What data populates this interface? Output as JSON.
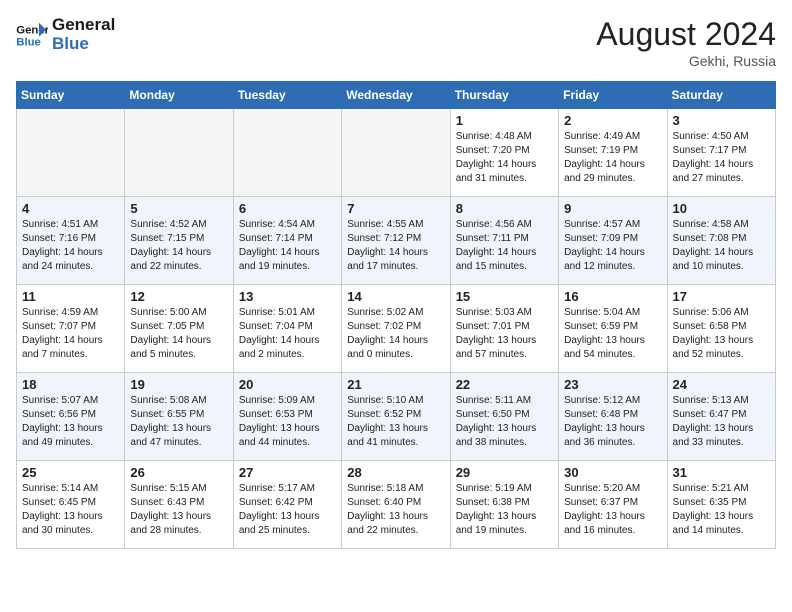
{
  "header": {
    "logo_line1": "General",
    "logo_line2": "Blue",
    "month_year": "August 2024",
    "location": "Gekhi, Russia"
  },
  "weekdays": [
    "Sunday",
    "Monday",
    "Tuesday",
    "Wednesday",
    "Thursday",
    "Friday",
    "Saturday"
  ],
  "weeks": [
    [
      {
        "day": "",
        "info": ""
      },
      {
        "day": "",
        "info": ""
      },
      {
        "day": "",
        "info": ""
      },
      {
        "day": "",
        "info": ""
      },
      {
        "day": "1",
        "info": "Sunrise: 4:48 AM\nSunset: 7:20 PM\nDaylight: 14 hours\nand 31 minutes."
      },
      {
        "day": "2",
        "info": "Sunrise: 4:49 AM\nSunset: 7:19 PM\nDaylight: 14 hours\nand 29 minutes."
      },
      {
        "day": "3",
        "info": "Sunrise: 4:50 AM\nSunset: 7:17 PM\nDaylight: 14 hours\nand 27 minutes."
      }
    ],
    [
      {
        "day": "4",
        "info": "Sunrise: 4:51 AM\nSunset: 7:16 PM\nDaylight: 14 hours\nand 24 minutes."
      },
      {
        "day": "5",
        "info": "Sunrise: 4:52 AM\nSunset: 7:15 PM\nDaylight: 14 hours\nand 22 minutes."
      },
      {
        "day": "6",
        "info": "Sunrise: 4:54 AM\nSunset: 7:14 PM\nDaylight: 14 hours\nand 19 minutes."
      },
      {
        "day": "7",
        "info": "Sunrise: 4:55 AM\nSunset: 7:12 PM\nDaylight: 14 hours\nand 17 minutes."
      },
      {
        "day": "8",
        "info": "Sunrise: 4:56 AM\nSunset: 7:11 PM\nDaylight: 14 hours\nand 15 minutes."
      },
      {
        "day": "9",
        "info": "Sunrise: 4:57 AM\nSunset: 7:09 PM\nDaylight: 14 hours\nand 12 minutes."
      },
      {
        "day": "10",
        "info": "Sunrise: 4:58 AM\nSunset: 7:08 PM\nDaylight: 14 hours\nand 10 minutes."
      }
    ],
    [
      {
        "day": "11",
        "info": "Sunrise: 4:59 AM\nSunset: 7:07 PM\nDaylight: 14 hours\nand 7 minutes."
      },
      {
        "day": "12",
        "info": "Sunrise: 5:00 AM\nSunset: 7:05 PM\nDaylight: 14 hours\nand 5 minutes."
      },
      {
        "day": "13",
        "info": "Sunrise: 5:01 AM\nSunset: 7:04 PM\nDaylight: 14 hours\nand 2 minutes."
      },
      {
        "day": "14",
        "info": "Sunrise: 5:02 AM\nSunset: 7:02 PM\nDaylight: 14 hours\nand 0 minutes."
      },
      {
        "day": "15",
        "info": "Sunrise: 5:03 AM\nSunset: 7:01 PM\nDaylight: 13 hours\nand 57 minutes."
      },
      {
        "day": "16",
        "info": "Sunrise: 5:04 AM\nSunset: 6:59 PM\nDaylight: 13 hours\nand 54 minutes."
      },
      {
        "day": "17",
        "info": "Sunrise: 5:06 AM\nSunset: 6:58 PM\nDaylight: 13 hours\nand 52 minutes."
      }
    ],
    [
      {
        "day": "18",
        "info": "Sunrise: 5:07 AM\nSunset: 6:56 PM\nDaylight: 13 hours\nand 49 minutes."
      },
      {
        "day": "19",
        "info": "Sunrise: 5:08 AM\nSunset: 6:55 PM\nDaylight: 13 hours\nand 47 minutes."
      },
      {
        "day": "20",
        "info": "Sunrise: 5:09 AM\nSunset: 6:53 PM\nDaylight: 13 hours\nand 44 minutes."
      },
      {
        "day": "21",
        "info": "Sunrise: 5:10 AM\nSunset: 6:52 PM\nDaylight: 13 hours\nand 41 minutes."
      },
      {
        "day": "22",
        "info": "Sunrise: 5:11 AM\nSunset: 6:50 PM\nDaylight: 13 hours\nand 38 minutes."
      },
      {
        "day": "23",
        "info": "Sunrise: 5:12 AM\nSunset: 6:48 PM\nDaylight: 13 hours\nand 36 minutes."
      },
      {
        "day": "24",
        "info": "Sunrise: 5:13 AM\nSunset: 6:47 PM\nDaylight: 13 hours\nand 33 minutes."
      }
    ],
    [
      {
        "day": "25",
        "info": "Sunrise: 5:14 AM\nSunset: 6:45 PM\nDaylight: 13 hours\nand 30 minutes."
      },
      {
        "day": "26",
        "info": "Sunrise: 5:15 AM\nSunset: 6:43 PM\nDaylight: 13 hours\nand 28 minutes."
      },
      {
        "day": "27",
        "info": "Sunrise: 5:17 AM\nSunset: 6:42 PM\nDaylight: 13 hours\nand 25 minutes."
      },
      {
        "day": "28",
        "info": "Sunrise: 5:18 AM\nSunset: 6:40 PM\nDaylight: 13 hours\nand 22 minutes."
      },
      {
        "day": "29",
        "info": "Sunrise: 5:19 AM\nSunset: 6:38 PM\nDaylight: 13 hours\nand 19 minutes."
      },
      {
        "day": "30",
        "info": "Sunrise: 5:20 AM\nSunset: 6:37 PM\nDaylight: 13 hours\nand 16 minutes."
      },
      {
        "day": "31",
        "info": "Sunrise: 5:21 AM\nSunset: 6:35 PM\nDaylight: 13 hours\nand 14 minutes."
      }
    ]
  ]
}
